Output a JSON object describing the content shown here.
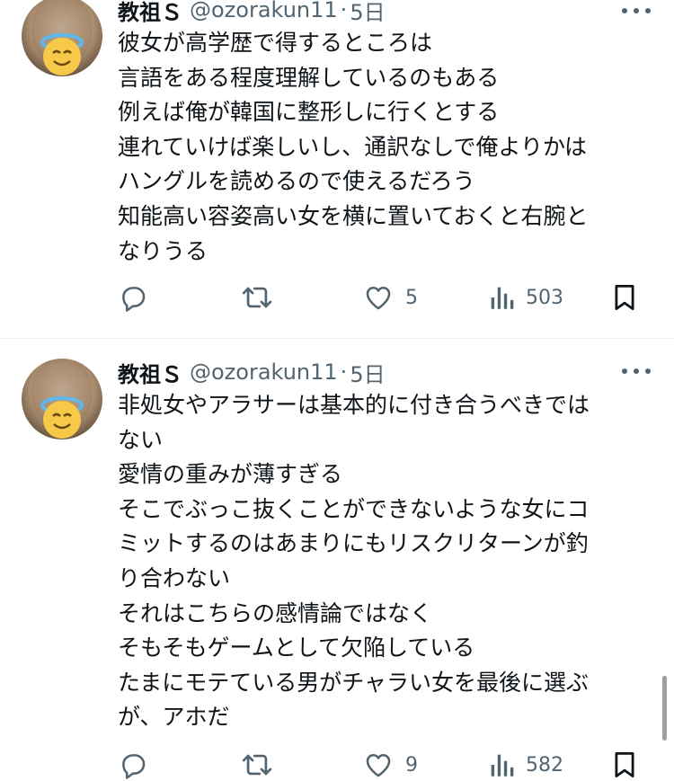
{
  "posts": [
    {
      "author": {
        "name": "教祖Ｓ",
        "handle": "@ozorakun11",
        "separator": "·",
        "time": "5日",
        "avatar_icon": "angel-face-emoji"
      },
      "lines": [
        "彼女が高学歴で得するところは",
        "言語をある程度理解しているのもある",
        "例えば俺が韓国に整形しに行くとする",
        "連れていけば楽しいし、通訳なしで俺よりかは",
        "ハングルを読めるので使えるだろう",
        "知能高い容姿高い女を横に置いておくと右腕と",
        "なりうる"
      ],
      "actions": {
        "reply_count": "",
        "repost_count": "",
        "like_count": "5",
        "view_count": "503"
      }
    },
    {
      "author": {
        "name": "教祖Ｓ",
        "handle": "@ozorakun11",
        "separator": "·",
        "time": "5日",
        "avatar_icon": "angel-face-emoji"
      },
      "lines": [
        "非処女やアラサーは基本的に付き合うべきでは",
        "ない",
        "愛情の重みが薄すぎる",
        "そこでぶっこ抜くことができないような女にコ",
        "ミットするのはあまりにもリスクリターンが釣",
        "り合わない",
        "それはこちらの感情論ではなく",
        "そもそもゲームとして欠陥している",
        "たまにモテている男がチャラい女を最後に選ぶ",
        "が、アホだ"
      ],
      "actions": {
        "reply_count": "",
        "repost_count": "",
        "like_count": "9",
        "view_count": "582"
      }
    }
  ],
  "icons": {
    "reply": "reply-icon",
    "repost": "repost-icon",
    "like": "heart-icon",
    "views": "views-chart-icon",
    "bookmark": "bookmark-icon",
    "more": "more-dots-icon"
  },
  "colors": {
    "text": "#0f1419",
    "secondary": "#536471",
    "divider": "#eff3f4"
  }
}
